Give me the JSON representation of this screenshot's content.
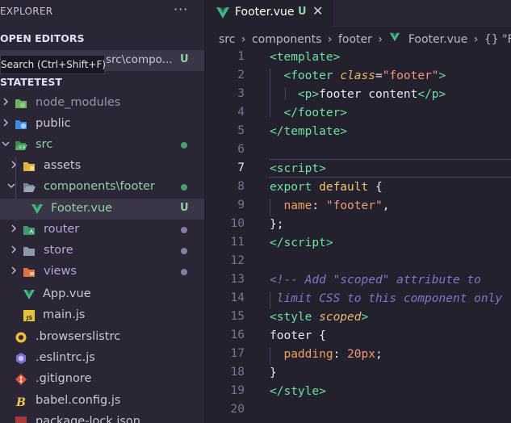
{
  "sidebar": {
    "title": "EXPLORER",
    "more": "···",
    "open_editors": "OPEN EDITORS",
    "open_editor_path": "src\\compo...",
    "open_editor_badge": "U",
    "tooltip": "Search (Ctrl+Shift+F)",
    "project": "STATETEST",
    "items": [
      {
        "label": "node_modules",
        "color": "#9a94a8"
      },
      {
        "label": "public",
        "color": "#cbc6d6"
      },
      {
        "label": "src",
        "color": "#8fd1a3"
      },
      {
        "label": "assets",
        "color": "#cbc6d6"
      },
      {
        "label": "components\\footer",
        "color": "#8fd1a3"
      },
      {
        "label": "Footer.vue",
        "color": "#8fd1a3",
        "badge": "U"
      },
      {
        "label": "router",
        "color": "#b9a6d6"
      },
      {
        "label": "store",
        "color": "#b9a6d6"
      },
      {
        "label": "views",
        "color": "#b9a6d6"
      },
      {
        "label": "App.vue",
        "color": "#cbc6d6"
      },
      {
        "label": "main.js",
        "color": "#cbc6d6"
      },
      {
        "label": ".browserslistrc",
        "color": "#cbc6d6"
      },
      {
        "label": ".eslintrc.js",
        "color": "#cbc6d6"
      },
      {
        "label": ".gitignore",
        "color": "#cbc6d6"
      },
      {
        "label": "babel.config.js",
        "color": "#cbc6d6"
      },
      {
        "label": "package-lock.json",
        "color": "#cbc6d6"
      }
    ]
  },
  "editor": {
    "tab_label": "Footer.vue",
    "tab_badge": "U",
    "tab_close": "✕",
    "breadcrumb": [
      "src",
      "components",
      "footer",
      "Footer.vue",
      "{} \"Fo"
    ],
    "line_numbers": [
      "1",
      "2",
      "3",
      "4",
      "5",
      "6",
      "7",
      "8",
      "9",
      "10",
      "11",
      "12",
      "13",
      "14",
      "15",
      "16",
      "17",
      "18",
      "19",
      "20"
    ],
    "active_line": "7"
  },
  "colors": {
    "vue_green": "#41b883",
    "untracked": "#8fd1a3",
    "modified_dot": "#8a7aa6"
  }
}
